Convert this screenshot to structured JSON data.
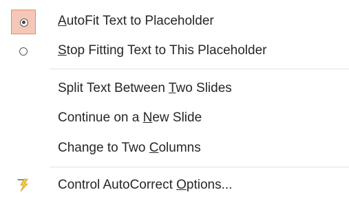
{
  "menu": {
    "items": [
      {
        "pre": "",
        "ul": "A",
        "post": "utoFit Text to Placeholder",
        "icon": "radio-checked-icon",
        "checked": true
      },
      {
        "pre": "",
        "ul": "S",
        "post": "top Fitting Text to This Placeholder",
        "icon": "radio-unchecked-icon",
        "checked": false
      },
      {
        "pre": "Split Text Between ",
        "ul": "T",
        "post": "wo Slides",
        "icon": "",
        "checked": false
      },
      {
        "pre": "Continue on a ",
        "ul": "N",
        "post": "ew Slide",
        "icon": "",
        "checked": false
      },
      {
        "pre": "Change to Two ",
        "ul": "C",
        "post": "olumns",
        "icon": "",
        "checked": false
      },
      {
        "pre": "Control AutoCorrect ",
        "ul": "O",
        "post": "ptions...",
        "icon": "autocorrect-lightning-icon",
        "checked": false
      }
    ]
  },
  "colors": {
    "checked_bg": "#f4c7b8",
    "checked_border": "#e48a6e",
    "text": "#262626",
    "separator": "#e1e1e1"
  }
}
